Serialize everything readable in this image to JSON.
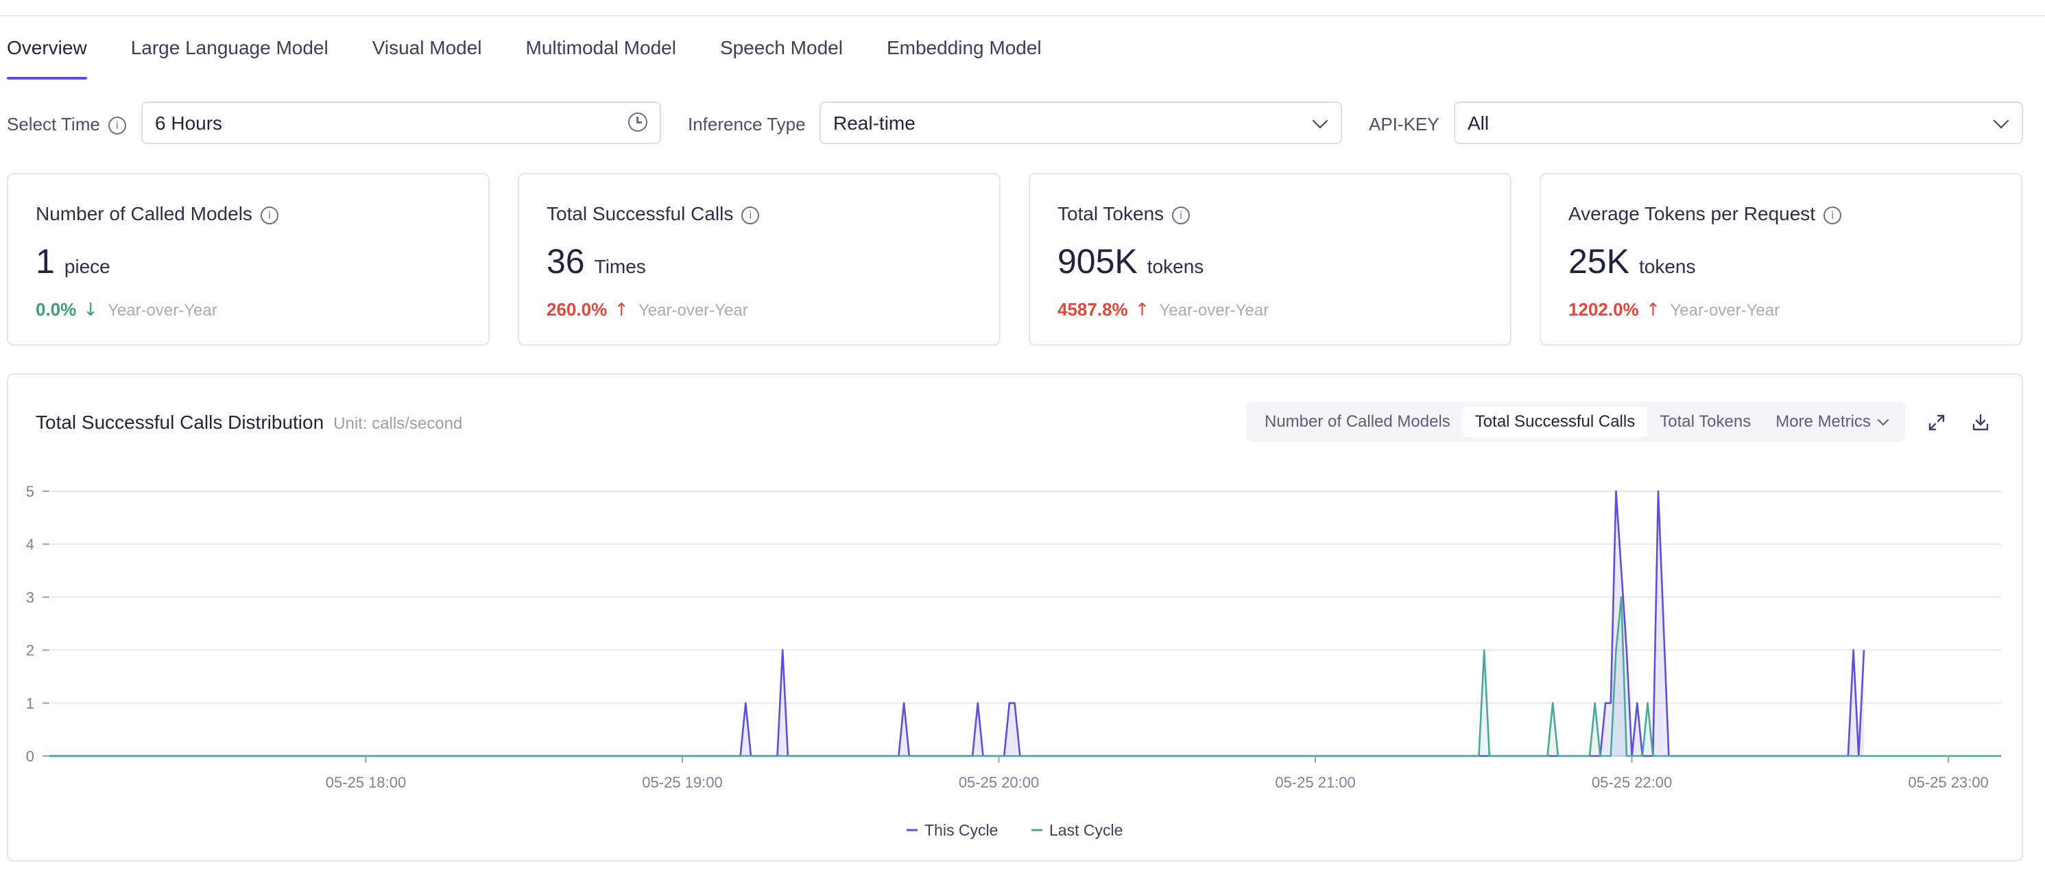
{
  "tabs": [
    {
      "label": "Overview",
      "active": true
    },
    {
      "label": "Large Language Model",
      "active": false
    },
    {
      "label": "Visual Model",
      "active": false
    },
    {
      "label": "Multimodal Model",
      "active": false
    },
    {
      "label": "Speech Model",
      "active": false
    },
    {
      "label": "Embedding Model",
      "active": false
    }
  ],
  "filters": {
    "time": {
      "label": "Select Time",
      "value": "6 Hours"
    },
    "inference": {
      "label": "Inference Type",
      "value": "Real-time"
    },
    "apikey": {
      "label": "API-KEY",
      "value": "All"
    }
  },
  "cards": [
    {
      "title": "Number of Called Models",
      "value": "1",
      "unit": "piece",
      "change": "0.0%",
      "direction": "down",
      "compare": "Year-over-Year"
    },
    {
      "title": "Total Successful Calls",
      "value": "36",
      "unit": "Times",
      "change": "260.0%",
      "direction": "up",
      "compare": "Year-over-Year"
    },
    {
      "title": "Total Tokens",
      "value": "905K",
      "unit": "tokens",
      "change": "4587.8%",
      "direction": "up",
      "compare": "Year-over-Year"
    },
    {
      "title": "Average Tokens per Request",
      "value": "25K",
      "unit": "tokens",
      "change": "1202.0%",
      "direction": "up",
      "compare": "Year-over-Year"
    }
  ],
  "panel": {
    "title": "Total Successful Calls Distribution",
    "unit": "Unit: calls/second",
    "metrics": [
      "Number of Called Models",
      "Total Successful Calls",
      "Total Tokens",
      "More Metrics"
    ],
    "active_metric": "Total Successful Calls"
  },
  "colors": {
    "accent": "#5b4fdc",
    "this_cycle": "#5b4fdc",
    "last_cycle": "#4aa89a",
    "up": "#e0483c",
    "down": "#3f9f6e"
  },
  "icons": {
    "fullscreen": "expand-icon",
    "download": "download-icon",
    "info": "info-icon",
    "time": "clock-icon",
    "dropdown": "chevron-down-icon"
  },
  "chart_data": {
    "type": "line",
    "title": "Total Successful Calls Distribution",
    "ylabel": "",
    "xlabel": "",
    "ylim": [
      0,
      5
    ],
    "yticks": [
      0,
      1,
      2,
      3,
      4,
      5
    ],
    "xlim": [
      "05-25 17:00",
      "05-25 23:10"
    ],
    "xticks": [
      "05-25 18:00",
      "05-25 19:00",
      "05-25 20:00",
      "05-25 21:00",
      "05-25 22:00",
      "05-25 23:00"
    ],
    "grid": true,
    "legend": "bottom-center",
    "series": [
      {
        "name": "This Cycle",
        "color": "#5b4fdc",
        "points": [
          [
            "05-25 17:00",
            0
          ],
          [
            "05-25 19:11",
            0
          ],
          [
            "05-25 19:12",
            1
          ],
          [
            "05-25 19:13",
            0
          ],
          [
            "05-25 19:18",
            0
          ],
          [
            "05-25 19:19",
            2
          ],
          [
            "05-25 19:20",
            0
          ],
          [
            "05-25 19:41",
            0
          ],
          [
            "05-25 19:42",
            1
          ],
          [
            "05-25 19:43",
            0
          ],
          [
            "05-25 19:55",
            0
          ],
          [
            "05-25 19:56",
            1
          ],
          [
            "05-25 19:57",
            0
          ],
          [
            "05-25 20:01",
            0
          ],
          [
            "05-25 20:02",
            1
          ],
          [
            "05-25 20:03",
            1
          ],
          [
            "05-25 20:04",
            0
          ],
          [
            "05-25 21:54",
            0
          ],
          [
            "05-25 21:55",
            1
          ],
          [
            "05-25 21:56",
            1
          ],
          [
            "05-25 21:57",
            5
          ],
          [
            "05-25 21:59",
            2
          ],
          [
            "05-25 22:00",
            0
          ],
          [
            "05-25 22:01",
            1
          ],
          [
            "05-25 22:02",
            0
          ],
          [
            "05-25 22:04",
            0
          ],
          [
            "05-25 22:05",
            5
          ],
          [
            "05-25 22:07",
            0
          ],
          [
            "05-25 22:41",
            0
          ],
          [
            "05-25 22:42",
            2
          ],
          [
            "05-25 22:43",
            0
          ],
          [
            "05-25 22:44",
            2
          ]
        ]
      },
      {
        "name": "Last Cycle",
        "color": "#4aa89a",
        "points": [
          [
            "05-25 17:00",
            0
          ],
          [
            "05-25 21:31",
            0
          ],
          [
            "05-25 21:32",
            2
          ],
          [
            "05-25 21:33",
            0
          ],
          [
            "05-25 21:44",
            0
          ],
          [
            "05-25 21:45",
            1
          ],
          [
            "05-25 21:46",
            0
          ],
          [
            "05-25 21:52",
            0
          ],
          [
            "05-25 21:53",
            1
          ],
          [
            "05-25 21:54",
            0
          ],
          [
            "05-25 21:56",
            0
          ],
          [
            "05-25 21:57",
            2
          ],
          [
            "05-25 21:58",
            3
          ],
          [
            "05-25 21:59",
            0
          ],
          [
            "05-25 22:02",
            0
          ],
          [
            "05-25 22:03",
            1
          ],
          [
            "05-25 22:04",
            0
          ],
          [
            "05-25 23:10",
            0
          ]
        ]
      }
    ]
  }
}
